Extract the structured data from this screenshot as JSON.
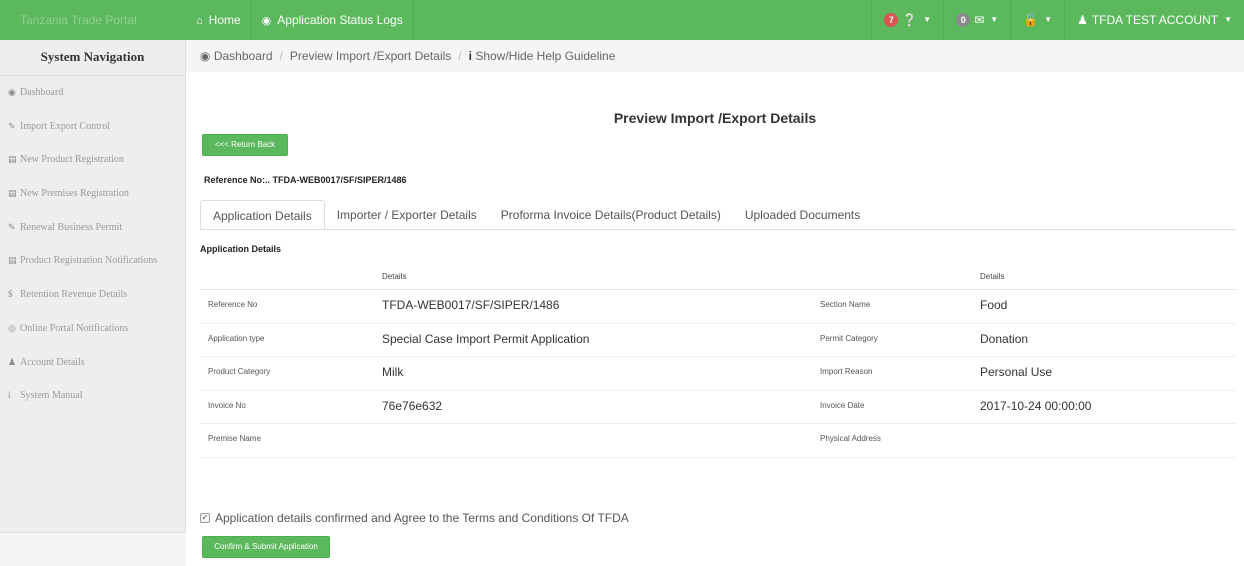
{
  "brand": {
    "text": "Tanzania Trade Portal"
  },
  "topnav": {
    "home": "Home",
    "status_logs": "Application Status Logs",
    "alerts_count": "7",
    "messages_count": "0",
    "account": "TFDA TEST ACCOUNT"
  },
  "sidebar": {
    "title": "System Navigation",
    "items": [
      {
        "icon": "dashboard-icon",
        "label": "Dashboard"
      },
      {
        "icon": "pencil-icon",
        "label": "Import Export Control"
      },
      {
        "icon": "folder-icon",
        "label": "New Product Registration"
      },
      {
        "icon": "folder-icon",
        "label": "New Premises Registration"
      },
      {
        "icon": "pencil-icon",
        "label": "Renewal Business Permit"
      },
      {
        "icon": "folder-icon",
        "label": "Product Registration Notifications"
      },
      {
        "icon": "dollar-icon",
        "label": "Retention Revenue Details"
      },
      {
        "icon": "globe-icon",
        "label": "Online Portal Notifications"
      },
      {
        "icon": "user-icon",
        "label": "Account Details"
      },
      {
        "icon": "info-icon",
        "label": "System Manual"
      }
    ]
  },
  "breadcrumb": {
    "dashboard": "Dashboard",
    "current": "Preview Import /Export Details",
    "help": "Show/Hide Help Guideline"
  },
  "page": {
    "title": "Preview Import /Export Details",
    "return_button": "<<< Return Back",
    "reference_line": "Reference No:.. TFDA-WEB0017/SF/SIPER/1486"
  },
  "tabs": [
    "Application Details",
    "Importer / Exporter Details",
    "Proforma Invoice Details(Product Details)",
    "Uploaded Documents"
  ],
  "details": {
    "section_heading": "Application Details",
    "header_left": "Details",
    "header_right": "Details",
    "rows": [
      {
        "label1": "Reference No",
        "value1": "TFDA-WEB0017/SF/SIPER/1486",
        "label2": "Section Name",
        "value2": "Food"
      },
      {
        "label1": "Application type",
        "value1": "Special Case Import Permit Application",
        "label2": "Permit Category",
        "value2": "Donation"
      },
      {
        "label1": "Product Category",
        "value1": "Milk",
        "label2": "Import Reason",
        "value2": "Personal Use"
      },
      {
        "label1": "Invoice No",
        "value1": "76e76e632",
        "label2": "Invoice Date",
        "value2": "2017-10-24 00:00:00"
      },
      {
        "label1": "Premise Name",
        "value1": "",
        "label2": "Physical Address",
        "value2": ""
      }
    ]
  },
  "confirm": {
    "text": "Application details confirmed and Agree to the Terms and Conditions Of TFDA",
    "checked": true,
    "submit_button": "Confirm & Submit Application"
  },
  "colors": {
    "primary_green": "#5cb85c",
    "badge_red": "#d9534f"
  }
}
